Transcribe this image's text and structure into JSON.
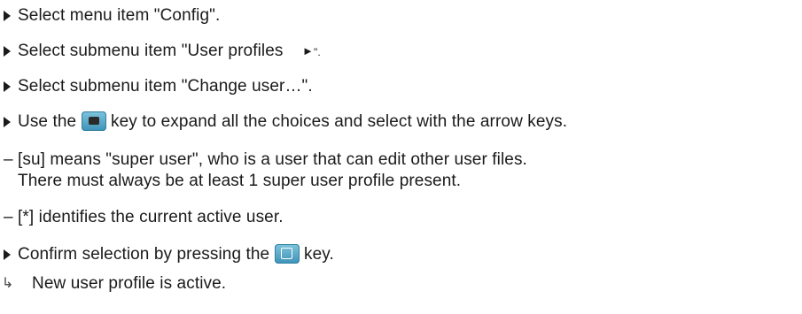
{
  "steps": [
    {
      "marker": "bullet",
      "before": "Select menu item \"Config\".",
      "after": ""
    },
    {
      "marker": "bullet",
      "before": "Select submenu item \"User profiles",
      "arrow": "►",
      "after": "\"."
    },
    {
      "marker": "bullet",
      "before": "Select submenu item \"Change user…\".",
      "after": ""
    },
    {
      "marker": "bullet",
      "before": "Use the",
      "key_icon": "menu-key-icon",
      "after": "key to expand all the choices and select with the arrow keys."
    },
    {
      "marker": "–",
      "before": "[su] means \"super user\", who is a user that can edit other user files.",
      "after": ""
    },
    {
      "marker": "",
      "before": "There must always be at least 1 super user profile present.",
      "after": ""
    },
    {
      "marker": "–",
      "before": "[*] identifies the current active user.",
      "after": ""
    },
    {
      "marker": "bullet",
      "before": "Confirm selection by pressing the",
      "key_icon": "confirm-key-icon",
      "after": "key."
    },
    {
      "marker": "result",
      "result_icon": "result-arrow-icon",
      "before": "New user profile is active.",
      "after": ""
    }
  ]
}
